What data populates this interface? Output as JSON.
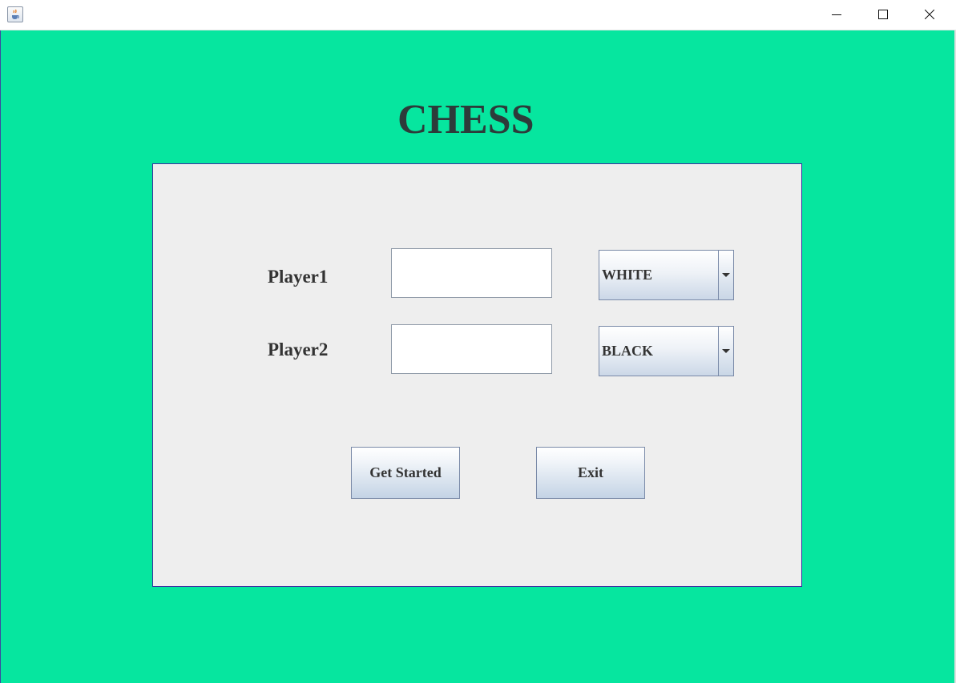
{
  "window": {
    "icon": "java-cup-icon",
    "controls": [
      "minimize-icon",
      "maximize-icon",
      "close-icon"
    ]
  },
  "title": "CHESS",
  "form": {
    "player1_label": "Player1",
    "player1_value": "",
    "player1_color": "WHITE",
    "player2_label": "Player2",
    "player2_value": "",
    "player2_color": "BLACK"
  },
  "buttons": {
    "start_label": "Get Started",
    "exit_label": "Exit"
  },
  "colors": {
    "background": "#06e69f",
    "panel": "#eeeeee",
    "title_text": "#2d3b3a"
  }
}
